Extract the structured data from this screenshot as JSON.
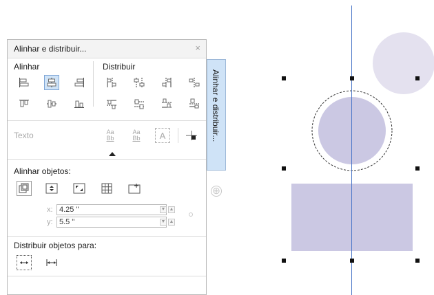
{
  "panel": {
    "title": "Alinhar e distribuir...",
    "close_glyph": "×",
    "align_header": "Alinhar",
    "distribute_header": "Distribuir",
    "text_label": "Texto",
    "align_objects_label": "Alinhar objetos:",
    "x_label": "x:",
    "x_value": "4.25 \"",
    "y_label": "y:",
    "y_value": "5.5 \"",
    "distribute_to_label": "Distribuir objetos para:",
    "aa_glyph_1": "Aa",
    "bb_glyph_1": "Bb",
    "aa_glyph_2": "Aa",
    "bb_glyph_2": "Bb",
    "text_box_glyph": "A"
  },
  "tab": {
    "label": "Alinhar e distribuir..."
  },
  "colors": {
    "shape_fill": "#cbc8e3",
    "shape_fill_light": "#e4e1ef",
    "guide": "#4f79c9",
    "selected_button": "#cfe3f7",
    "tab_bg": "#cfe3f7"
  },
  "icons": {
    "align_left": "align-left-icon",
    "align_center_h": "align-center-horizontal-icon",
    "align_right": "align-right-icon",
    "align_top": "align-top-icon",
    "align_center_v": "align-center-vertical-icon",
    "align_bottom": "align-bottom-icon",
    "spin_up": "▲",
    "spin_down": "▼",
    "lock": "lock-icon",
    "add_tab": "⊕"
  }
}
